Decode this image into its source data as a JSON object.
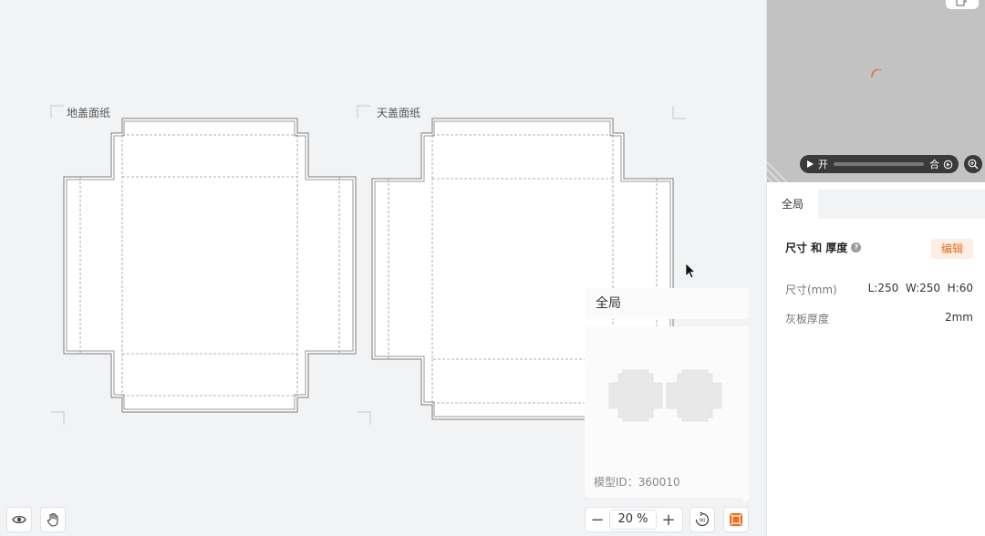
{
  "canvas": {
    "panels": [
      {
        "label": "地盖面纸"
      },
      {
        "label": "天盖面纸"
      }
    ]
  },
  "overview": {
    "title": "全局",
    "model_id_text": "模型ID：360010"
  },
  "zoom": {
    "minus": "−",
    "value": "20 %",
    "plus": "+"
  },
  "preview": {
    "open_label": "开",
    "close_label": "合"
  },
  "right_panel": {
    "tab_label": "全局",
    "section_title": "尺寸 和 厚度",
    "edit_label": "编辑",
    "rows": [
      {
        "label": "尺寸(mm)",
        "value": "L:250  W:250  H:60"
      },
      {
        "label": "灰板厚度",
        "value": "2mm"
      }
    ]
  },
  "colors": {
    "accent": "#f06a1f",
    "canvas_bg": "#f2f3f5",
    "preview_bg": "#c2c2c2"
  },
  "icons": {
    "eye": "eye-icon",
    "hand": "hand-icon",
    "rotate": "rotate-90-icon",
    "box3d": "box-3d-icon",
    "play": "play-icon",
    "replay": "replay-icon",
    "zoom_in": "zoom-in-icon",
    "help": "help-icon"
  }
}
